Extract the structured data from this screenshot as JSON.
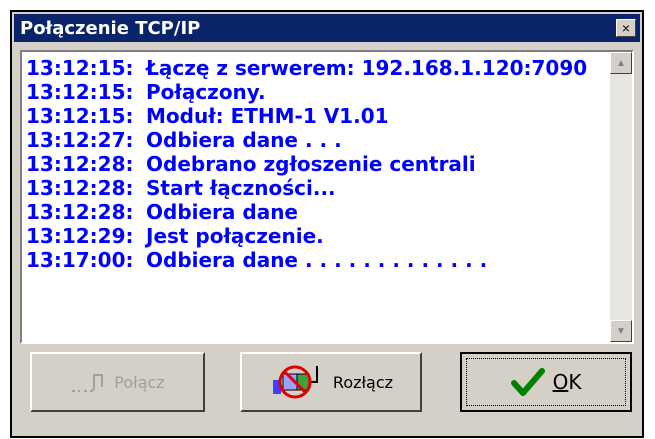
{
  "window": {
    "title": "Połączenie TCP/IP",
    "close_label": "×"
  },
  "log": [
    {
      "time": "13:12:15:",
      "msg": "Łączę z serwerem: 192.168.1.120:7090"
    },
    {
      "time": "13:12:15:",
      "msg": "Połączony."
    },
    {
      "time": "13:12:15:",
      "msg": "Moduł: ETHM-1 V1.01"
    },
    {
      "time": "13:12:27:",
      "msg": "Odbiera dane . . ."
    },
    {
      "time": "13:12:28:",
      "msg": "Odebrano zgłoszenie centrali"
    },
    {
      "time": "13:12:28:",
      "msg": "Start łączności..."
    },
    {
      "time": "13:12:28:",
      "msg": "Odbiera dane"
    },
    {
      "time": "13:12:29:",
      "msg": "Jest połączenie."
    },
    {
      "time": "13:17:00:",
      "msg": "Odbiera dane  . . . . . . . . . . . . ."
    }
  ],
  "buttons": {
    "connect": "Połącz",
    "disconnect": "Rozłącz",
    "ok_underlined": "O",
    "ok_rest": "K"
  },
  "colors": {
    "title_bg": "#0a246a",
    "log_text": "#0000ff",
    "window_bg": "#d4d0c8"
  }
}
